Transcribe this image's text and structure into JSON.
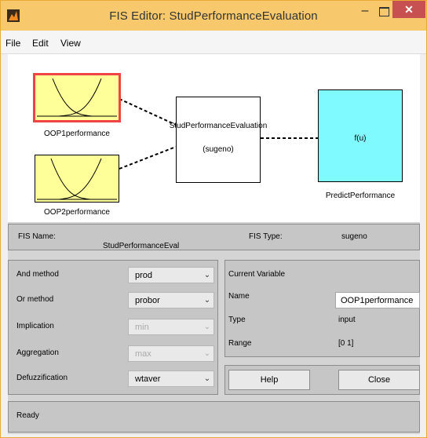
{
  "window": {
    "title": "FIS Editor: StudPerformanceEvaluation",
    "minimize_glyph": "–",
    "close_glyph": "✕"
  },
  "menu": {
    "items": [
      "File",
      "Edit",
      "View"
    ]
  },
  "diagram": {
    "inputs": [
      {
        "name": "OOP1performance",
        "selected": true
      },
      {
        "name": "OOP2performance",
        "selected": false
      }
    ],
    "system": {
      "name": "StudPerformanceEvaluation",
      "type": "(sugeno)"
    },
    "output": {
      "name": "PredictPerformance",
      "function": "f(u)"
    }
  },
  "fis_info": {
    "name_label": "FIS Name:",
    "name_value": "StudPerformanceEval",
    "type_label": "FIS Type:",
    "type_value": "sugeno"
  },
  "methods": [
    {
      "label": "And method",
      "value": "prod",
      "enabled": true
    },
    {
      "label": "Or method",
      "value": "probor",
      "enabled": true
    },
    {
      "label": "Implication",
      "value": "min",
      "enabled": false
    },
    {
      "label": "Aggregation",
      "value": "max",
      "enabled": false
    },
    {
      "label": "Defuzzification",
      "value": "wtaver",
      "enabled": true
    }
  ],
  "current_variable": {
    "header": "Current Variable",
    "name_label": "Name",
    "name_value": "OOP1performance",
    "type_label": "Type",
    "type_value": "input",
    "range_label": "Range",
    "range_value": "[0 1]"
  },
  "buttons": {
    "help": "Help",
    "close": "Close"
  },
  "status": {
    "text": "Ready"
  },
  "colors": {
    "input_box": "#ffff99",
    "output_box": "#7ffaff",
    "selected_border": "#ee4444",
    "title_bar": "#f7c96c",
    "close_button": "#c75050"
  },
  "dropdown_arrow": "⌄"
}
